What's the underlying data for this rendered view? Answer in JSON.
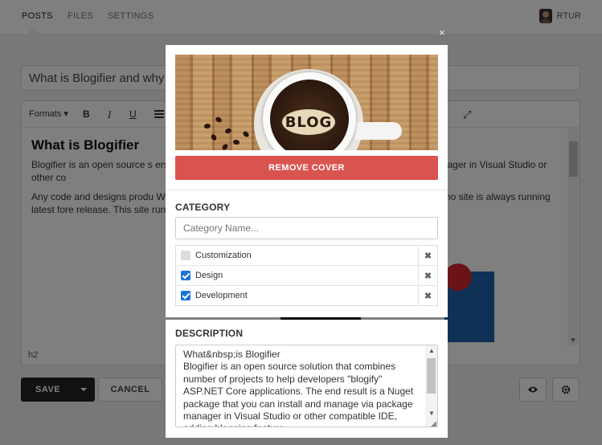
{
  "nav": {
    "tabs": [
      {
        "label": "POSTS",
        "active": true
      },
      {
        "label": "FILES",
        "active": false
      },
      {
        "label": "SETTINGS",
        "active": false
      }
    ],
    "user": "RTUR"
  },
  "post": {
    "title": "What is Blogifier and why",
    "toolbar": {
      "formats_label": "Formats",
      "bold": "B",
      "italic": "I",
      "underline": "U"
    },
    "heading": "What is Blogifier",
    "paragraphs": [
      "Blogifier is an open source s                                                    ers \"blogify\" ASP.NET Core applications. The end r                                                    via package manager in Visual Studio or other co",
      "Any code and designs produ                                                    When code merged into master branch, it trigge                                                    ght now) so our demo site is always running latest                                                    fore release. This site runs on Windows server wit"
    ],
    "status_path": "h2"
  },
  "actions": {
    "save_label": "SAVE",
    "cancel_label": "CANCEL",
    "preview_icon": "eye-icon",
    "settings_icon": "gear-icon"
  },
  "modal": {
    "close_glyph": "×",
    "cover_text": "BLOG",
    "remove_cover_label": "REMOVE COVER",
    "category": {
      "label": "CATEGORY",
      "placeholder": "Category Name...",
      "items": [
        {
          "name": "Customization",
          "checked": false
        },
        {
          "name": "Design",
          "checked": true
        },
        {
          "name": "Development",
          "checked": true
        }
      ],
      "delete_glyph": "✖"
    },
    "description": {
      "label": "DESCRIPTION",
      "value": "What&nbsp;is Blogifier\nBlogifier is an open source solution that combines number of projects to help developers \"blogify\" ASP.NET Core applications. The end result is a Nuget package that you can install and manage via package manager in Visual Studio or other compatible IDE, adding blogging feature"
    }
  },
  "colors": {
    "danger": "#d9534f",
    "checkbox": "#1a73d9",
    "save_button": "#222222"
  }
}
